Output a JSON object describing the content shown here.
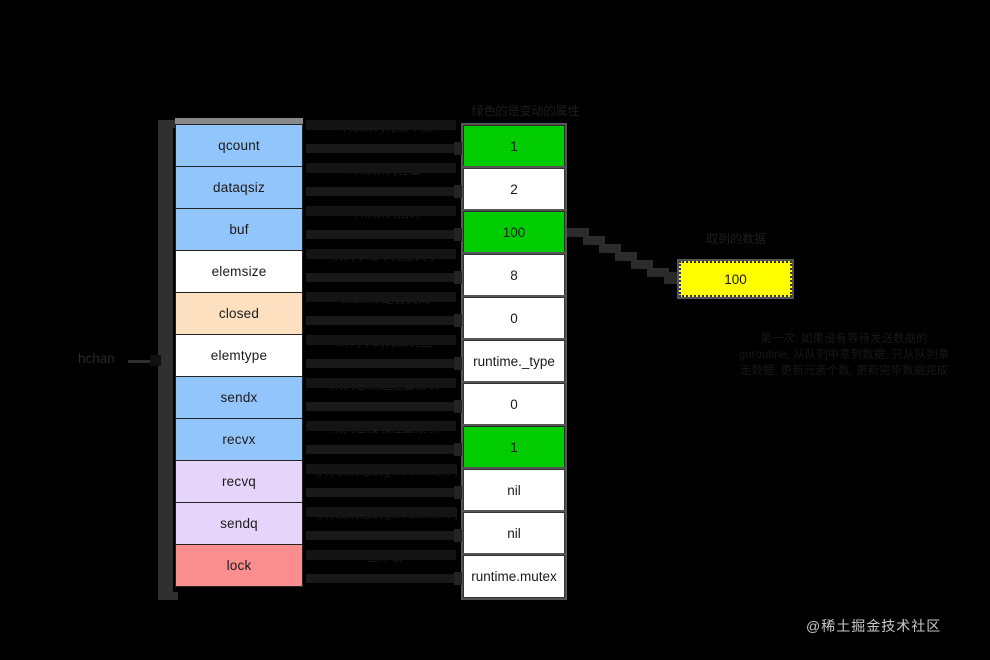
{
  "diagram": {
    "root_label": "hchan",
    "value_column_title": "绿色的是变动的属性",
    "yellow_title": "取到的数据",
    "yellow_value": "100",
    "note": "第一次: 如果没有等待发送数据的goroutine, 从队列中拿到数据, 只从队列拿走数据, 更新元素个数, 更新完毕数据完成",
    "watermark": "@稀土掘金技术社区"
  },
  "fields": [
    {
      "name": "qcount",
      "desc": "环形队列元素个数",
      "value": "1",
      "color": "#93c5fd",
      "highlight": true
    },
    {
      "name": "dataqsiz",
      "desc": "环形队列容量",
      "value": "2",
      "color": "#93c5fd",
      "highlight": false
    },
    {
      "name": "buf",
      "desc": "环形队列指针",
      "value": "100",
      "color": "#93c5fd",
      "highlight": true
    },
    {
      "name": "elemsize",
      "desc": "队列中每个元素大小",
      "value": "8",
      "color": "#ffffff",
      "highlight": false
    },
    {
      "name": "closed",
      "desc": "channel是否关闭",
      "value": "0",
      "color": "#fde0c0",
      "highlight": false
    },
    {
      "name": "elemtype",
      "desc": "队列中的元素类型",
      "value": "runtime._type",
      "color": "#ffffff",
      "highlight": false
    },
    {
      "name": "sendx",
      "desc": "队列已发送位置索引",
      "value": "0",
      "color": "#93c5fd",
      "highlight": false
    },
    {
      "name": "recvx",
      "desc": "队列已接收位置索引",
      "value": "1",
      "color": "#93c5fd",
      "highlight": true
    },
    {
      "name": "recvq",
      "desc": "等待读消息的goroutine队列",
      "value": "nil",
      "color": "#e6d4fb",
      "highlight": false
    },
    {
      "name": "sendq",
      "desc": "写待发消息的goroutine队列",
      "value": "nil",
      "color": "#e6d4fb",
      "highlight": false
    },
    {
      "name": "lock",
      "desc": "互斥锁",
      "value": "runtime.mutex",
      "color": "#fa8e8e",
      "highlight": false
    }
  ],
  "colors": {
    "background": "#000000",
    "highlight_green": "#00cc00",
    "data_yellow": "#ffff00",
    "brace_gray": "#303030"
  }
}
